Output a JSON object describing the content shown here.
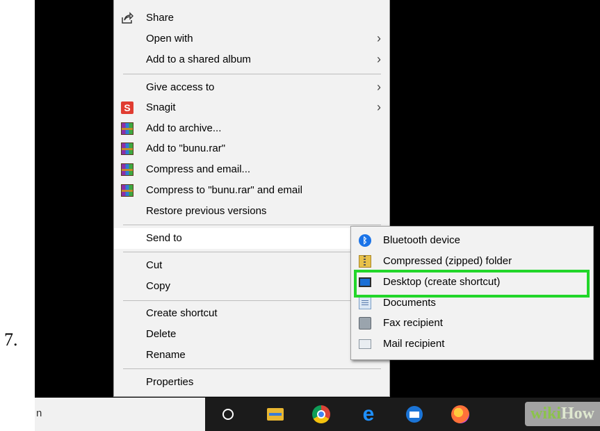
{
  "step_number": "7.",
  "context_menu": {
    "items": [
      {
        "label": "Share",
        "icon": "share-icon",
        "submenu": false
      },
      {
        "label": "Open with",
        "icon": "",
        "submenu": true
      },
      {
        "label": "Add to a shared album",
        "icon": "",
        "submenu": true
      },
      {
        "label": "Give access to",
        "icon": "",
        "submenu": true
      },
      {
        "label": "Snagit",
        "icon": "snagit-icon",
        "submenu": true
      },
      {
        "label": "Add to archive...",
        "icon": "winrar-icon",
        "submenu": false
      },
      {
        "label": "Add to \"bunu.rar\"",
        "icon": "winrar-icon",
        "submenu": false
      },
      {
        "label": "Compress and email...",
        "icon": "winrar-icon",
        "submenu": false
      },
      {
        "label": "Compress to \"bunu.rar\" and email",
        "icon": "winrar-icon",
        "submenu": false
      },
      {
        "label": "Restore previous versions",
        "icon": "",
        "submenu": false
      },
      {
        "label": "Send to",
        "icon": "",
        "submenu": true,
        "hovered": true
      },
      {
        "label": "Cut",
        "icon": "",
        "submenu": false
      },
      {
        "label": "Copy",
        "icon": "",
        "submenu": false
      },
      {
        "label": "Create shortcut",
        "icon": "",
        "submenu": false
      },
      {
        "label": "Delete",
        "icon": "",
        "submenu": false
      },
      {
        "label": "Rename",
        "icon": "",
        "submenu": false
      },
      {
        "label": "Properties",
        "icon": "",
        "submenu": false
      }
    ],
    "submenu_arrow": "›"
  },
  "send_to_menu": {
    "items": [
      {
        "label": "Bluetooth device",
        "icon": "bluetooth-icon"
      },
      {
        "label": "Compressed (zipped) folder",
        "icon": "zip-folder-icon"
      },
      {
        "label": "Desktop (create shortcut)",
        "icon": "desktop-icon",
        "highlighted": true
      },
      {
        "label": "Documents",
        "icon": "documents-icon"
      },
      {
        "label": "Fax recipient",
        "icon": "fax-icon"
      },
      {
        "label": "Mail recipient",
        "icon": "mail-recipient-icon"
      }
    ],
    "highlight_color": "#22d62a"
  },
  "taskbar": {
    "search_fragment": "n",
    "icons": [
      "cortana-icon",
      "file-explorer-icon",
      "chrome-icon",
      "edge-icon",
      "mail-app-icon",
      "firefox-icon"
    ]
  },
  "watermark": {
    "part1": "wiki",
    "part2": "How"
  }
}
